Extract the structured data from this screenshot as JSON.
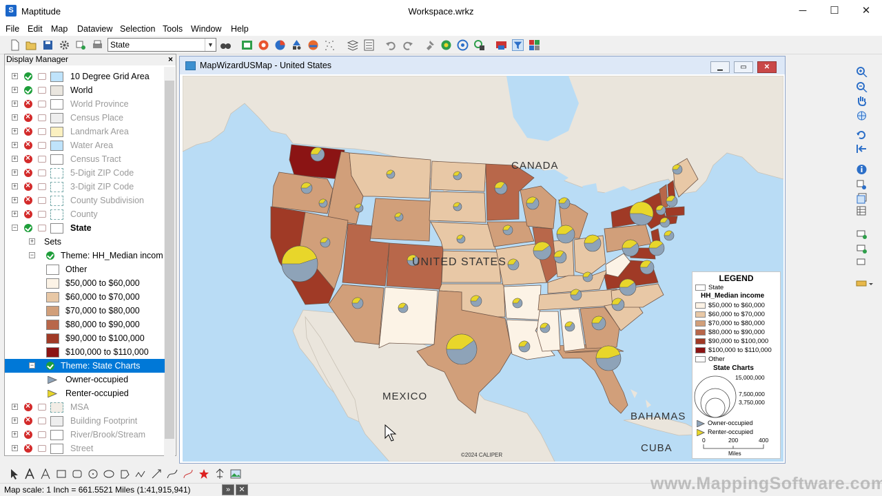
{
  "app": {
    "name": "Maptitude",
    "workspace": "Workspace.wrkz",
    "icon_letter": "S",
    "window_controls": {
      "minimize": "─",
      "maximize": "☐",
      "close": "✕"
    }
  },
  "menu": [
    "File",
    "Edit",
    "Map",
    "Dataview",
    "Selection",
    "Tools",
    "Window",
    "Help"
  ],
  "toolbar": {
    "layer_select_value": "State"
  },
  "display_manager": {
    "title": "Display Manager",
    "close": "×",
    "layers": [
      {
        "label": "10 Degree Grid Area",
        "visible": true,
        "swatch": "#bfe3fb"
      },
      {
        "label": "World",
        "visible": true,
        "swatch": "#eae6df"
      },
      {
        "label": "World Province",
        "visible": false,
        "swatch": "#ffffff"
      },
      {
        "label": "Census Place",
        "visible": false,
        "swatch": "#eeeeee"
      },
      {
        "label": "Landmark Area",
        "visible": false,
        "swatch": "#fbf0c0"
      },
      {
        "label": "Water Area",
        "visible": false,
        "swatch": "#bfe3fb"
      },
      {
        "label": "Census Tract",
        "visible": false,
        "swatch": "#ffffff"
      },
      {
        "label": "5-Digit ZIP Code",
        "visible": false,
        "swatch": "#ffffff"
      },
      {
        "label": "3-Digit ZIP Code",
        "visible": false,
        "swatch": "#ffffff"
      },
      {
        "label": "County Subdivision",
        "visible": false,
        "swatch": "#ffffff"
      },
      {
        "label": "County",
        "visible": false,
        "swatch": "#ffffff"
      },
      {
        "label": "State",
        "visible": true,
        "swatch": "#ffffff"
      }
    ],
    "sets_label": "Sets",
    "theme_income": "Theme: HH_Median incom",
    "income_classes": [
      {
        "label": "Other",
        "color": "#ffffff"
      },
      {
        "label": "$50,000 to $60,000",
        "color": "#fcf3e6"
      },
      {
        "label": "$60,000 to $70,000",
        "color": "#e8c8a6"
      },
      {
        "label": "$70,000 to $80,000",
        "color": "#d19f7a"
      },
      {
        "label": "$80,000 to $90,000",
        "color": "#b8674a"
      },
      {
        "label": "$90,000 to $100,000",
        "color": "#a03a26"
      },
      {
        "label": "$100,000 to $110,000",
        "color": "#8b1414"
      }
    ],
    "theme_charts": "Theme: State Charts",
    "chart_items": [
      {
        "label": "Owner-occupied",
        "color": "#8ea3b8"
      },
      {
        "label": "Renter-occupied",
        "color": "#e8d62a"
      }
    ],
    "more_layers": [
      {
        "label": "MSA"
      },
      {
        "label": "Building Footprint"
      },
      {
        "label": "River/Brook/Stream"
      },
      {
        "label": "Street"
      }
    ]
  },
  "map_window": {
    "title": "MapWizardUSMap - United States",
    "buttons": {
      "minimize": "▭",
      "restore": "▭",
      "close": "✕"
    },
    "labels": {
      "canada": "CANADA",
      "us": "UNITED STATES",
      "mexico": "MEXICO",
      "bahamas": "BAHAMAS",
      "cuba": "CUBA",
      "copyright": "©2024 CALIPER"
    },
    "colors": {
      "ocean": "#b9dcf5",
      "land": "#eae5dc",
      "c1": "#fcf3e6",
      "c2": "#e8c8a6",
      "c3": "#d19f7a",
      "c4": "#b8674a",
      "c5": "#a03a26",
      "c6": "#8b1414",
      "owner": "#8ea3b8",
      "renter": "#e8d62a"
    }
  },
  "legend": {
    "title": "LEGEND",
    "state_label": "State",
    "income_title": "HH_Median income",
    "income_rows": [
      {
        "label": "$50,000 to $60,000",
        "color": "#fcf3e6"
      },
      {
        "label": "$60,000 to $70,000",
        "color": "#e8c8a6"
      },
      {
        "label": "$70,000 to $80,000",
        "color": "#d19f7a"
      },
      {
        "label": "$80,000 to $90,000",
        "color": "#b8674a"
      },
      {
        "label": "$90,000 to $100,000",
        "color": "#a03a26"
      },
      {
        "label": "$100,000 to $110,000",
        "color": "#8b1414"
      },
      {
        "label": "Other",
        "color": "#ffffff"
      }
    ],
    "charts_title": "State Charts",
    "circle_values": [
      "15,000,000",
      "7,500,000",
      "3,750,000"
    ],
    "chart_series": [
      {
        "label": "Owner-occupied",
        "color": "#8ea3b8"
      },
      {
        "label": "Renter-occupied",
        "color": "#e8d62a"
      }
    ],
    "scale_ticks": [
      "0",
      "200",
      "400"
    ],
    "scale_unit": "Miles"
  },
  "status": {
    "text": "Map scale: 1 Inch = 661.5521 Miles (1:41,915,941)",
    "btn1": "»",
    "btn2": "✕"
  },
  "watermark": "www.MappingSoftware.com"
}
